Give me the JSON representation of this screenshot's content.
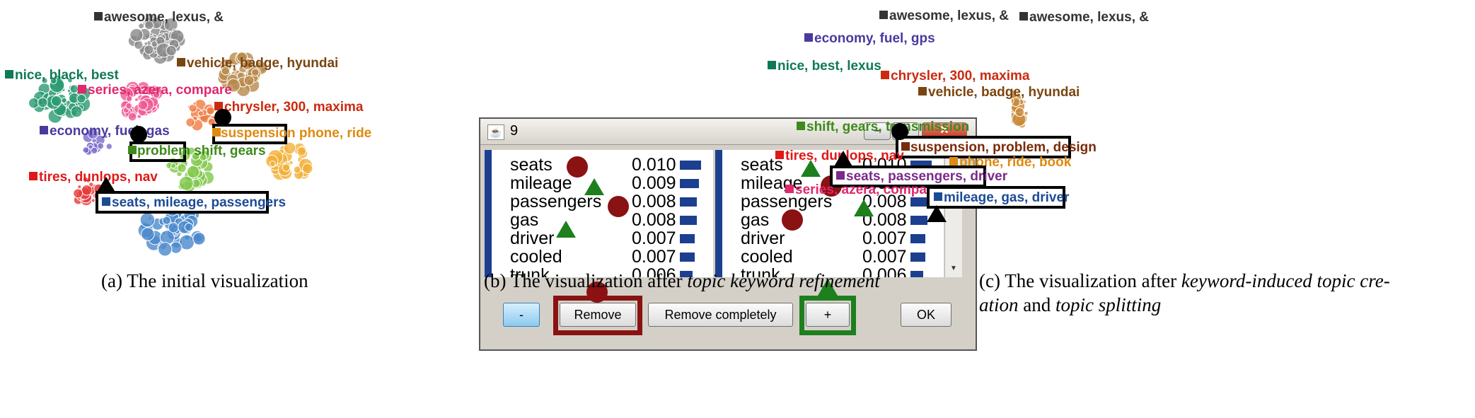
{
  "panel_a": {
    "labels": {
      "awesome": "awesome, lexus, &",
      "vehicle": "vehicle, badge, hyundai",
      "nice": "nice, black, best",
      "series": "series, azera, compare",
      "chrysler": "chrysler, 300, maxima",
      "economy": "economy, fuel, gas",
      "suspension_hl": "suspension",
      "suspension_rest": " phone, ride",
      "problem_hl": "problem",
      "problem_rest": " shift, gears",
      "tires": "tires, dunlops, nav",
      "seats": "seats, mileage, passengers"
    },
    "colors": {
      "awesome": "#333333",
      "vehicle": "#7a4510",
      "nice": "#0f7a55",
      "series": "#e0286e",
      "chrysler": "#cc2a10",
      "economy": "#4a3a9e",
      "suspension": "#de8a10",
      "problem": "#3e8a1a",
      "tires": "#e01818",
      "seats": "#1c4b96"
    }
  },
  "panel_b": {
    "window_title": "9",
    "left_list": [
      {
        "word": "seats",
        "value": "0.010",
        "bar": 0.01
      },
      {
        "word": "mileage",
        "value": "0.009",
        "bar": 0.009
      },
      {
        "word": "passengers",
        "value": "0.008",
        "bar": 0.008
      },
      {
        "word": "gas",
        "value": "0.008",
        "bar": 0.008
      },
      {
        "word": "driver",
        "value": "0.007",
        "bar": 0.007
      },
      {
        "word": "cooled",
        "value": "0.007",
        "bar": 0.007
      },
      {
        "word": "trunk",
        "value": "0.006",
        "bar": 0.006
      }
    ],
    "right_list": [
      {
        "word": "seats",
        "value": "0.010",
        "bar": 0.01
      },
      {
        "word": "mileage",
        "value": "0.009",
        "bar": 0.009
      },
      {
        "word": "passengers",
        "value": "0.008",
        "bar": 0.008
      },
      {
        "word": "gas",
        "value": "0.008",
        "bar": 0.008
      },
      {
        "word": "driver",
        "value": "0.007",
        "bar": 0.007
      },
      {
        "word": "cooled",
        "value": "0.007",
        "bar": 0.007
      },
      {
        "word": "trunk",
        "value": "0.006",
        "bar": 0.006
      }
    ],
    "buttons": {
      "minus": "-",
      "remove": "Remove",
      "remove_completely": "Remove completely",
      "plus": "+",
      "ok": "OK"
    }
  },
  "panel_c": {
    "labels": {
      "awesome": "awesome, lexus, &",
      "economy": "economy, fuel, gps",
      "nice": "nice, best, lexus",
      "chrysler": "chrysler, 300, maxima",
      "vehicle": "vehicle, badge, hyundai",
      "shift": "shift, gears, transmission",
      "suspension": "suspension, problem, design",
      "tires": "tires, dunlops, nav",
      "phone": "phone, ride, book",
      "seats": "seats, passengers, driver",
      "series": "series, azera, compare",
      "mileage": "mileage, gas, driver"
    },
    "colors": {
      "awesome": "#333333",
      "economy": "#4a3a9e",
      "nice": "#0f7a55",
      "chrysler": "#cc2a10",
      "vehicle": "#7a4510",
      "shift": "#3e8a1a",
      "suspension": "#7a2a0a",
      "tires": "#e01818",
      "phone": "#de8a10",
      "seats": "#7a2a8a",
      "series": "#e0286e",
      "mileage": "#1c4b96"
    }
  },
  "captions": {
    "a": "(a) The initial visualization",
    "b_prefix": "(b) The visualization after ",
    "b_italic": "topic keyword refinement",
    "c_prefix": "(c) The visualization after ",
    "c_italic1": "keyword-induced topic cre-",
    "c_italic2": "ation",
    "c_mid": " and ",
    "c_italic3": "topic splitting"
  }
}
